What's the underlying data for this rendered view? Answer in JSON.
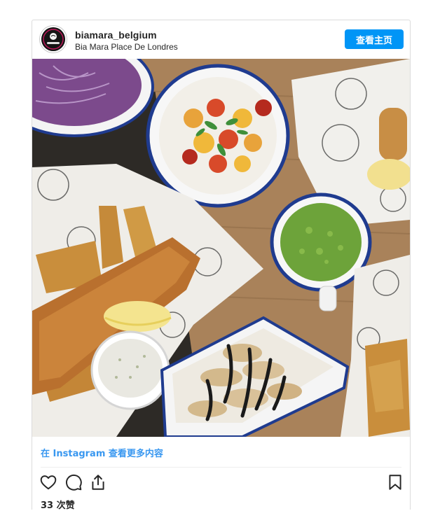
{
  "post": {
    "username": "biamara_belgium",
    "location": "Bia Mara Place De Londres",
    "profile_button": "查看主页",
    "avatar_text": "Bia Mara"
  },
  "footer": {
    "more_link": "在 Instagram 查看更多内容",
    "likes": "33 次赞"
  },
  "icons": [
    "heart-icon",
    "comment-icon",
    "share-icon",
    "bookmark-icon"
  ],
  "colors": {
    "accent": "#0095f6",
    "link": "#3897f0",
    "border": "#dbdbdb"
  }
}
